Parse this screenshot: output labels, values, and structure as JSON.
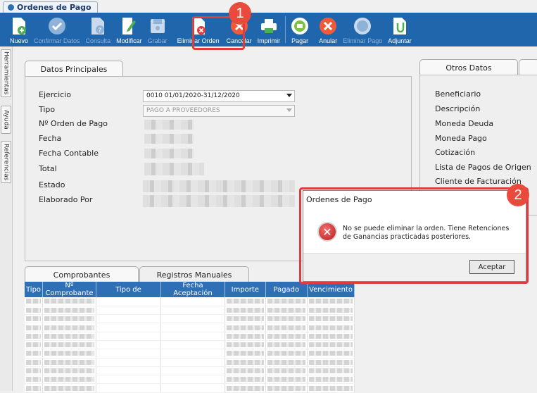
{
  "window_tab": "Ordenes de Pago",
  "toolbar": [
    {
      "label": "Nuevo",
      "icon": "new-doc-icon",
      "enabled": true
    },
    {
      "label": "Confirmar Datos",
      "icon": "check-icon",
      "enabled": false
    },
    {
      "label": "Consulta",
      "icon": "doc-query-icon",
      "enabled": false
    },
    {
      "label": "Modificar",
      "icon": "pencil-icon",
      "enabled": true
    },
    {
      "label": "Grabar",
      "icon": "disk-icon",
      "enabled": false
    },
    {
      "label": "Eliminar Orden",
      "icon": "delete-doc-icon",
      "enabled": true
    },
    {
      "label": "Cancelar",
      "icon": "cancel-icon",
      "enabled": true
    },
    {
      "label": "Imprimir",
      "icon": "printer-icon",
      "enabled": true
    },
    {
      "label": "Pagar",
      "icon": "coins-icon",
      "enabled": true
    },
    {
      "label": "Anular",
      "icon": "x-circle-icon",
      "enabled": true
    },
    {
      "label": "Eliminar Pago",
      "icon": "coins-delete-icon",
      "enabled": false
    },
    {
      "label": "Adjuntar",
      "icon": "attach-doc-icon",
      "enabled": true
    }
  ],
  "side_tabs": [
    "Herramientas",
    "Ayuda",
    "Referencias"
  ],
  "main_tab": "Datos Principales",
  "fields": {
    "ejercicio_label": "Ejercicio",
    "ejercicio_value": "0010 01/01/2020-31/12/2020",
    "tipo_label": "Tipo",
    "tipo_value": "PAGO A PROVEEDORES",
    "orden_label": "Nº Orden de Pago",
    "fecha_label": "Fecha",
    "fecha_contable_label": "Fecha Contable",
    "total_label": "Total",
    "estado_label": "Estado",
    "elaborado_label": "Elaborado Por"
  },
  "otros_tab": "Otros Datos",
  "otros_labels": [
    "Beneficiario",
    "Descripción",
    "Moneda Deuda",
    "Moneda Pago",
    "Cotización",
    "Lista de Pagos de Origen",
    "Cliente de Facturación"
  ],
  "bottom_tabs": [
    "Comprobantes",
    "Registros Manuales"
  ],
  "grid_columns": [
    "Tipo",
    "Nº Comprobante",
    "Tipo de",
    "Fecha Aceptación",
    "Importe",
    "Pagado",
    "Vencimiento"
  ],
  "dialog": {
    "title": "Ordenes de Pago",
    "message": "No se puede eliminar la orden. Tiene Retenciones de Ganancias practicadas posteriores.",
    "button": "Aceptar"
  },
  "callouts": [
    "1",
    "2"
  ],
  "colors": {
    "toolbar": "#1f66ad",
    "highlight": "#e03c3c",
    "badge": "#e84a3c",
    "grid_header": "#2e6fb5"
  }
}
